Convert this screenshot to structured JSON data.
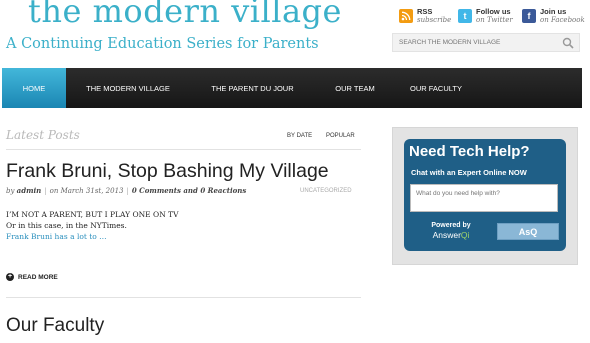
{
  "site": {
    "title": "the modern village",
    "tagline": "A Continuing Education Series for Parents"
  },
  "social": [
    {
      "icon": "rss-icon",
      "label": "RSS",
      "sub": "subscribe",
      "color": "#f39c12"
    },
    {
      "icon": "twitter-icon",
      "label": "Follow us",
      "sub": "on Twitter",
      "color": "#41b7e8"
    },
    {
      "icon": "facebook-icon",
      "label": "Join us",
      "sub": "on Facebook",
      "color": "#3b5998"
    }
  ],
  "search": {
    "placeholder": "SEARCH THE MODERN VILLAGE"
  },
  "nav": [
    {
      "label": "HOME",
      "active": true
    },
    {
      "label": "THE MODERN VILLAGE"
    },
    {
      "label": "THE PARENT DU JOUR"
    },
    {
      "label": "OUR TEAM"
    },
    {
      "label": "OUR FACULTY"
    }
  ],
  "main": {
    "latest_posts_title": "Latest Posts",
    "sort_by_date": "BY DATE",
    "sort_popular": "POPULAR",
    "post": {
      "title": "Frank Bruni, Stop Bashing My Village",
      "meta_by": "by",
      "author": "admin",
      "date": "on March 31st, 2013",
      "comments": "0 Comments and 0 Reactions",
      "category": "UNCATEGORIZED",
      "excerpt": [
        "I’M NOT A PARENT, BUT I PLAY ONE ON TV",
        "Or in this case, in the NYTimes.",
        "Frank Bruni has a lot to …"
      ],
      "read_more": "READ MORE"
    },
    "section_title": "Our Faculty"
  },
  "widget": {
    "title": "Need Tech Help?",
    "subtitle": "Chat with an Expert Online NOW",
    "input_placeholder": "What do you need help with?",
    "powered_by": "Powered by",
    "brand_a": "Answer",
    "brand_b": "Qi",
    "button": "AsQ",
    "bg_color": "#1f5f87"
  },
  "colors": {
    "accent": "#3bb0c9",
    "nav_active": "#2a9fcc",
    "link": "#2a8fbd"
  }
}
